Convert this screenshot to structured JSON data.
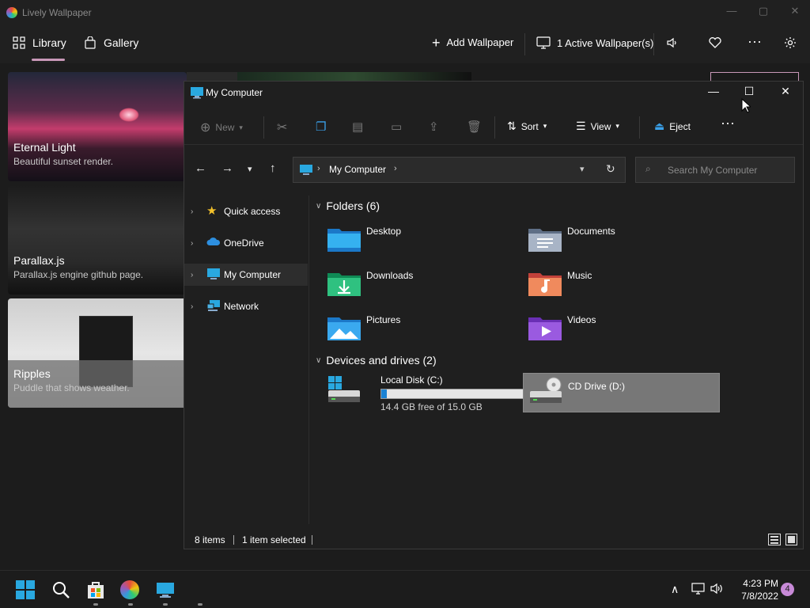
{
  "app": {
    "title": "Lively Wallpaper",
    "nav": {
      "library": "Library",
      "gallery": "Gallery"
    },
    "actions": {
      "add_wallpaper": "Add Wallpaper",
      "active_wallpapers": "1 Active Wallpaper(s)"
    }
  },
  "library": {
    "cards": [
      {
        "title": "Eternal Light",
        "desc": "Beautiful sunset render."
      },
      {
        "title": "Parallax.js",
        "desc": "Parallax.js engine github page."
      },
      {
        "title": "Ripples",
        "desc": "Puddle that shows weather."
      }
    ]
  },
  "explorer": {
    "title": "My Computer",
    "toolbar": {
      "new": "New",
      "sort": "Sort",
      "view": "View",
      "eject": "Eject"
    },
    "address": {
      "location": "My Computer",
      "search_placeholder": "Search My Computer"
    },
    "sidebar": [
      {
        "label": "Quick access"
      },
      {
        "label": "OneDrive"
      },
      {
        "label": "My Computer"
      },
      {
        "label": "Network"
      }
    ],
    "folders_header": "Folders (6)",
    "folders": [
      {
        "name": "Desktop"
      },
      {
        "name": "Documents"
      },
      {
        "name": "Downloads"
      },
      {
        "name": "Music"
      },
      {
        "name": "Pictures"
      },
      {
        "name": "Videos"
      }
    ],
    "drives_header": "Devices and drives (2)",
    "drives": [
      {
        "name": "Local Disk (C:)",
        "free": "14.4 GB free of 15.0 GB",
        "used_fraction": 0.04
      },
      {
        "name": "CD Drive (D:)"
      }
    ],
    "status": {
      "items": "8 items",
      "selected": "1 item selected"
    }
  },
  "taskbar": {
    "time": "4:23 PM",
    "date": "7/8/2022",
    "notifications": "4"
  },
  "colors": {
    "accent": "#1a82d4",
    "library_underline": "#c898b8",
    "notif_badge": "#c88ad8"
  }
}
